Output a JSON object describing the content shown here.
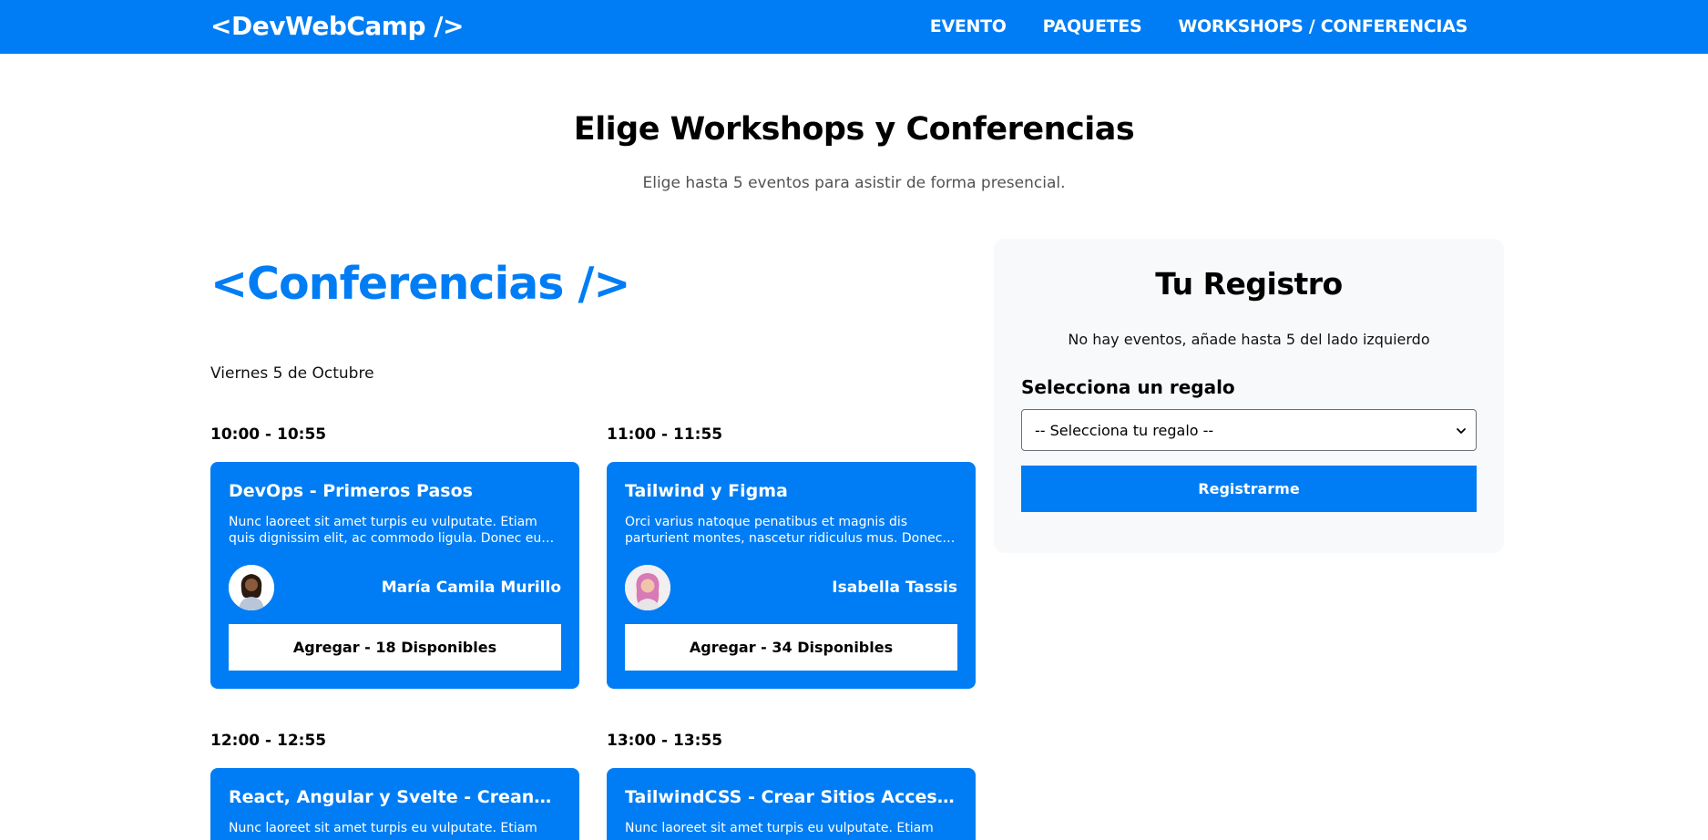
{
  "header": {
    "logo": "<DevWebCamp />",
    "nav": [
      "EVENTO",
      "PAQUETES",
      "WORKSHOPS / CONFERENCIAS"
    ]
  },
  "page": {
    "title": "Elige Workshops y Conferencias",
    "subtitle": "Elige hasta 5 eventos para asistir de forma presencial."
  },
  "conferencias": {
    "title": "<Conferencias />",
    "day": "Viernes 5 de Octubre",
    "slots": [
      {
        "time": "10:00 - 10:55",
        "title": "DevOps - Primeros Pasos",
        "description": "Nunc laoreet sit amet turpis eu vulputate. Etiam quis dignissim elit, ac commodo ligula. Donec eu lorem ipsum dolor",
        "speaker": "María Camila Murillo",
        "button": "Agregar - 18 Disponibles"
      },
      {
        "time": "11:00 - 11:55",
        "title": "Tailwind y Figma",
        "description": "Orci varius natoque penatibus et magnis dis parturient montes, nascetur ridiculus mus. Donec lorem ipsum",
        "speaker": "Isabella Tassis",
        "button": "Agregar - 34 Disponibles"
      },
      {
        "time": "12:00 - 12:55",
        "title": "React, Angular y Svelte - Creando una Aplicación",
        "description": "Nunc laoreet sit amet turpis eu vulputate. Etiam",
        "speaker": "",
        "button": ""
      },
      {
        "time": "13:00 - 13:55",
        "title": "TailwindCSS - Crear Sitios Accesibles",
        "description": "Nunc laoreet sit amet turpis eu vulputate. Etiam",
        "speaker": "",
        "button": ""
      }
    ]
  },
  "registro": {
    "title": "Tu Registro",
    "empty": "No hay eventos, añade hasta 5 del lado izquierdo",
    "gift_label": "Selecciona un regalo",
    "gift_selected": "-- Selecciona tu regalo --",
    "submit": "Registrarme"
  },
  "colors": {
    "primary": "#007df4",
    "panel": "#f8f9fb"
  }
}
